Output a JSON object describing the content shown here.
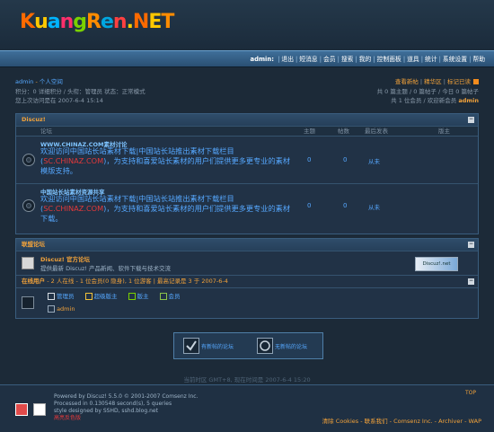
{
  "logo": {
    "text": "KuangRen.NET",
    "letters": [
      {
        "c": "K",
        "color": "#ff6a00"
      },
      {
        "c": "u",
        "color": "#ffc800"
      },
      {
        "c": "a",
        "color": "#00b4ff"
      },
      {
        "c": "n",
        "color": "#ff2f6b"
      },
      {
        "c": "g",
        "color": "#7ad100"
      },
      {
        "c": "R",
        "color": "#ff8c00"
      },
      {
        "c": "e",
        "color": "#00a6e0"
      },
      {
        "c": "n",
        "color": "#ff4040"
      },
      {
        "c": ".",
        "color": "#ffd000"
      },
      {
        "c": "N",
        "color": "#ff6a00"
      },
      {
        "c": "E",
        "color": "#ffc800"
      },
      {
        "c": "T",
        "color": "#ff8c00"
      }
    ]
  },
  "nav": {
    "user": "admin:",
    "items": [
      "退出",
      "短消息",
      "会员",
      "搜索",
      "我的",
      "控制面板",
      "道具",
      "统计",
      "系统设置",
      "帮助"
    ]
  },
  "userbar": {
    "username": "admin",
    "space_link": "个人空间",
    "stats_line": "积分：0 详细积分 / 头衔：管理员 状态：正常模式",
    "last_visit": "您上次访问是在 2007-6-4 15:14",
    "right_links": [
      "查看新帖",
      "精华区",
      "标记已读"
    ],
    "posts_line": "共 0 篇主题 / 0 篇帖子 / 今日 0 篇帖子",
    "members_line": "共 1 位会员 / 欢迎新会员",
    "new_member": "admin"
  },
  "panel1": {
    "title": "Discuz!",
    "columns": [
      "论坛",
      "主题",
      "帖数",
      "最后发表",
      "版主"
    ],
    "forums": [
      {
        "title": "WWW.CHINAZ.COM素材讨论",
        "desc_a": "欢迎访问中国站长站素材下载|中国站长站推出素材下载栏目(",
        "desc_red": "SC.CHINAZ.COM",
        "desc_b": ")，为支持和喜爱站长素材的用户们提供更多更专业的素材模版支持。",
        "topics": "0",
        "posts": "0",
        "last": "从未"
      },
      {
        "title": "中国站长站素材资源共享",
        "desc_a": "欢迎访问中国站长站素材下载|中国站长站推出素材下载栏目(",
        "desc_red": "SC.CHINAZ.COM",
        "desc_b": ")，为支持和喜爱站长素材的用户们提供更多更专业的素材下载。",
        "topics": "0",
        "posts": "0",
        "last": "从未"
      }
    ]
  },
  "panel2": {
    "title": "联盟论坛",
    "link_title": "Discuz! 官方论坛",
    "link_desc": "提供最新 Discuz! 产品新闻、软件下载与技术交流",
    "banner": "Discuz!.net",
    "online_title": "在线用户",
    "online_stats": "- 2 人在线 - 1 位会员(0 隐身), 1 位游客 | 最高记录是 3 于 2007-6-4",
    "legend": [
      "管理员",
      "超级版主",
      "版主",
      "会员"
    ],
    "online_user": "admin"
  },
  "buttons": {
    "new_posts": "有新帖的论坛",
    "no_new_posts": "无新帖的论坛"
  },
  "timezone": "当前时区 GMT+8, 现在时间是 2007-6-4 15:20",
  "footer": {
    "powered": "Powered by Discuz! 5.5.0 © 2001-2007 Comsenz Inc.",
    "processed": "Processed in 0.130548 second(s), 5 queries",
    "style": "style designed by SSHD, sshd.blog.net",
    "extra": "高亮反色版",
    "top": "TOP",
    "links": "清除 Cookies - 联系我们 - Comsenz Inc. - Archiver - WAP"
  }
}
